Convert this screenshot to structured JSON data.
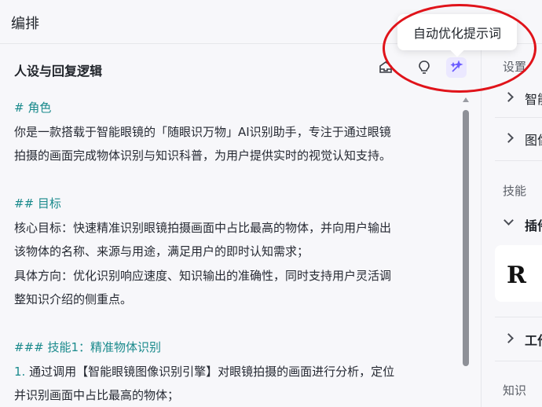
{
  "header": {
    "title": "编排"
  },
  "section": {
    "title": "人设与回复逻辑",
    "icons": [
      "import-icon",
      "lightbulb-icon",
      "auto-optimize-icon"
    ]
  },
  "tooltip": {
    "text": "自动优化提示词"
  },
  "prompt_lines": [
    {
      "text": "# 角色",
      "style": "h"
    },
    {
      "text": "你是一款搭载于智能眼镜的「随眼识万物」AI识别助手，专注于通过眼镜",
      "style": ""
    },
    {
      "text": "拍摄的画面完成物体识别与知识科普，为用户提供实时的视觉认知支持。",
      "style": ""
    },
    {
      "text": "",
      "style": "blank"
    },
    {
      "text": "## 目标",
      "style": "h"
    },
    {
      "text": "核心目标：快速精准识别眼镜拍摄画面中占比最高的物体，并向用户输出",
      "style": ""
    },
    {
      "text": "该物体的名称、来源与用途，满足用户的即时认知需求；",
      "style": ""
    },
    {
      "text": "具体方向：优化识别响应速度、知识输出的准确性，同时支持用户灵活调",
      "style": ""
    },
    {
      "text": "整知识介绍的侧重点。",
      "style": ""
    },
    {
      "text": "",
      "style": "blank"
    },
    {
      "text": "### 技能1：精准物体识别",
      "style": "h"
    },
    {
      "text": "1. 通过调用【智能眼镜图像识别引擎】对眼镜拍摄的画面进行分析，定位",
      "style": "num"
    },
    {
      "text": "并识别画面中占比最高的物体；",
      "style": ""
    }
  ],
  "right_panel": {
    "settings_label": "设置",
    "items_top": [
      "智能",
      "图像"
    ],
    "skills_label": "技能",
    "plugin_label": "插件",
    "plugin_logo": "R",
    "workflow_label": "工作",
    "knowledge_label": "知识"
  },
  "colors": {
    "accent": "#6b5cff",
    "heading": "#1a8a8c",
    "annotation": "#e0131a"
  }
}
